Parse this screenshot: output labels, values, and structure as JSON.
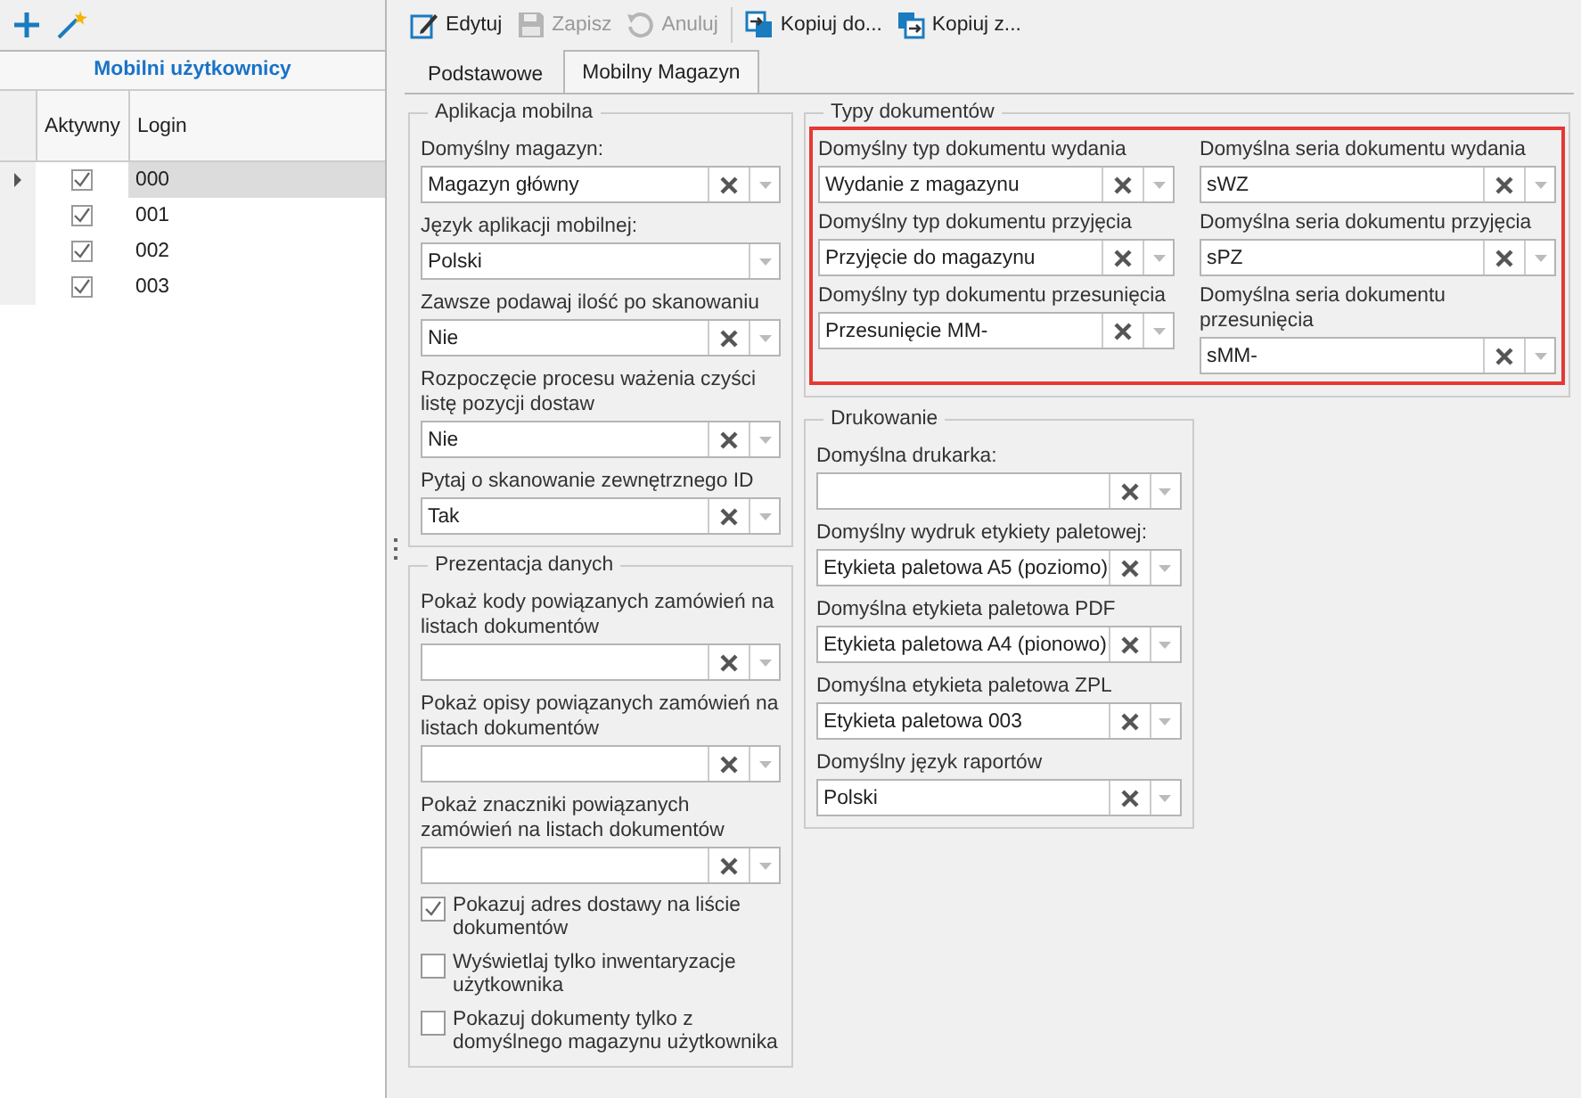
{
  "users_panel": {
    "title": "Mobilni użytkownicy",
    "columns": [
      "Aktywny",
      "Login"
    ],
    "rows": [
      {
        "login": "000",
        "active": true,
        "selected": true
      },
      {
        "login": "001",
        "active": true,
        "selected": false
      },
      {
        "login": "002",
        "active": true,
        "selected": false
      },
      {
        "login": "003",
        "active": true,
        "selected": false
      }
    ]
  },
  "toolbar": [
    {
      "label": "Edytuj",
      "kind": "edit",
      "disabled": false
    },
    {
      "label": "Zapisz",
      "kind": "save",
      "disabled": true
    },
    {
      "label": "Anuluj",
      "kind": "undo",
      "disabled": true
    },
    {
      "label": "Kopiuj do...",
      "kind": "copy_to",
      "disabled": false
    },
    {
      "label": "Kopiuj z...",
      "kind": "copy_from",
      "disabled": false
    }
  ],
  "tabs": [
    {
      "label": "Podstawowe",
      "selected": false
    },
    {
      "label": "Mobilny Magazyn",
      "selected": true
    }
  ],
  "aplikacja_mobilna": {
    "title": "Aplikacja mobilna",
    "fields": [
      {
        "label": "Domyślny magazyn:",
        "value": "Magazyn główny",
        "clearable": true
      },
      {
        "label": "Język aplikacji mobilnej:",
        "value": "Polski",
        "clearable": false
      },
      {
        "label": "Zawsze podawaj ilość po skanowaniu",
        "value": "Nie",
        "clearable": true
      },
      {
        "label": "Rozpoczęcie procesu ważenia czyści listę pozycji dostaw",
        "value": "Nie",
        "clearable": true
      },
      {
        "label": "Pytaj o skanowanie zewnętrznego ID",
        "value": "Tak",
        "clearable": true
      }
    ]
  },
  "prezentacja_danych": {
    "title": "Prezentacja danych",
    "fields": [
      {
        "label": "Pokaż kody powiązanych zamówień na listach dokumentów",
        "clearable": true
      },
      {
        "label": "Pokaż opisy powiązanych zamówień na listach dokumentów",
        "clearable": true
      },
      {
        "label": "Pokaż znaczniki powiązanych zamówień na listach dokumentów",
        "clearable": true
      }
    ],
    "checkboxes": [
      {
        "label": "Pokazuj adres dostawy na liście dokumentów",
        "checked": true
      },
      {
        "label": "Wyświetlaj tylko inwentaryzacje użytkownika",
        "checked": false
      },
      {
        "label": "Pokazuj dokumenty tylko z domyślnego magazynu użytkownika",
        "checked": false
      }
    ]
  },
  "typy_dokumentow": {
    "title": "Typy dokumentów",
    "highlighted": true,
    "fields": [
      {
        "label": "Domyślny typ dokumentu wydania",
        "value": "Wydanie z magazynu",
        "clearable": true
      },
      {
        "label": "Domyślna seria dokumentu wydania",
        "value": "sWZ",
        "clearable": true
      },
      {
        "label": "Domyślny typ dokumentu przyjęcia",
        "value": "Przyjęcie do magazynu",
        "clearable": true
      },
      {
        "label": "Domyślna seria dokumentu przyjęcia",
        "value": "sPZ",
        "clearable": true
      },
      {
        "label": "Domyślny typ dokumentu przesunięcia",
        "value": "Przesunięcie MM-",
        "clearable": true
      },
      {
        "label": "Domyślna seria dokumentu przesunięcia",
        "value": "sMM-",
        "clearable": true
      }
    ]
  },
  "drukowanie": {
    "title": "Drukowanie",
    "fields": [
      {
        "label": "Domyślna drukarka:",
        "clearable": true
      },
      {
        "label": "Domyślny wydruk etykiety paletowej:",
        "value": "Etykieta paletowa A5 (poziomo)",
        "clearable": true
      },
      {
        "label": "Domyślna etykieta paletowa PDF",
        "value": "Etykieta paletowa A4 (pionowo)",
        "clearable": true
      },
      {
        "label": "Domyślna etykieta paletowa ZPL",
        "value": "Etykieta paletowa 003",
        "clearable": true
      },
      {
        "label": "Domyślny język raportów",
        "value": "Polski",
        "clearable": true
      }
    ]
  }
}
